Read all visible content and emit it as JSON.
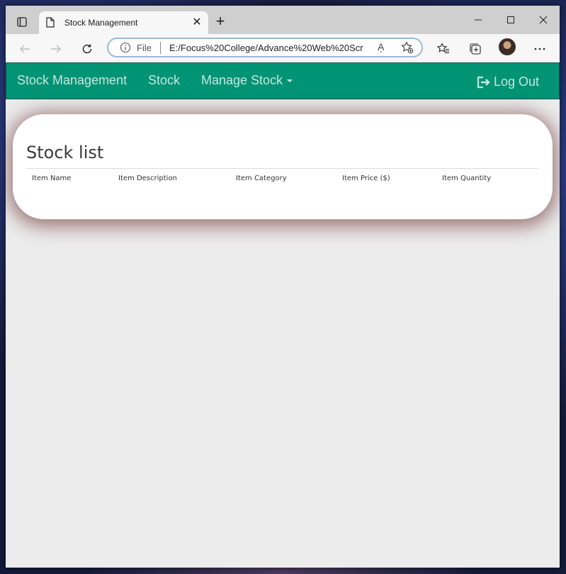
{
  "browser": {
    "tab_title": "Stock Management",
    "address_scheme": "File",
    "address_url": "E:/Focus%20College/Advance%20Web%20Scr",
    "read_aloud_glyph": "Aͅ"
  },
  "navbar": {
    "brand": "Stock Management",
    "links": [
      "Stock",
      "Manage Stock"
    ],
    "logout": "Log Out",
    "bg_color": "#009475"
  },
  "stock_list": {
    "title": "Stock list",
    "columns": [
      "Item Name",
      "Item Description",
      "Item Category",
      "Item Price ($)",
      "Item Quantity"
    ]
  }
}
